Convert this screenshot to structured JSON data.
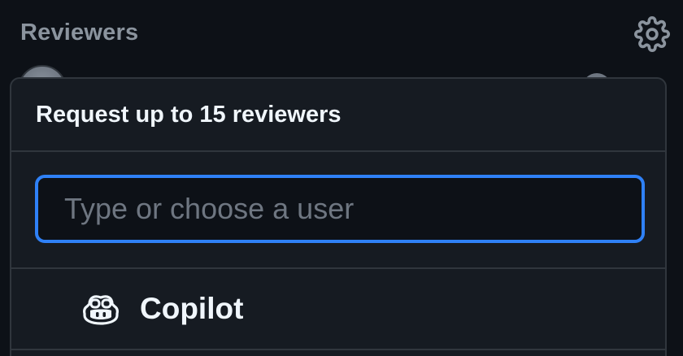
{
  "sidebar": {
    "title": "Reviewers",
    "settings_icon": "gear-icon"
  },
  "popover": {
    "title": "Request up to 15 reviewers",
    "filter": {
      "placeholder": "Type or choose a user",
      "value": ""
    },
    "suggestions": [
      {
        "label": "Copilot",
        "icon": "copilot-icon"
      }
    ]
  },
  "colors": {
    "background": "#0d1117",
    "panel": "#161b22",
    "border": "#30363d",
    "focus": "#2f81f7",
    "muted_text": "#8b949e",
    "text": "#f0f6fc"
  }
}
